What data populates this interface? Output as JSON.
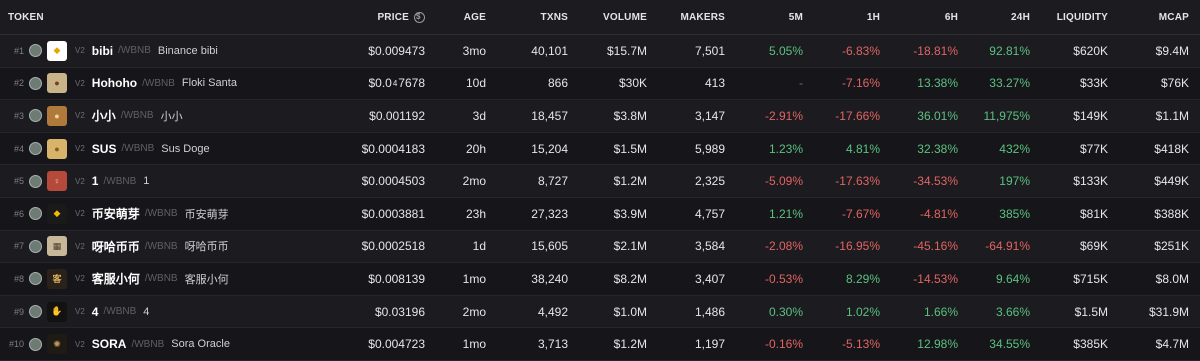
{
  "columns": {
    "token": "TOKEN",
    "price": "PRICE",
    "age": "AGE",
    "txns": "TXNS",
    "volume": "VOLUME",
    "makers": "MAKERS",
    "m5": "5M",
    "h1": "1H",
    "h6": "6H",
    "h24": "24H",
    "liquidity": "LIQUIDITY",
    "mcap": "MCAP"
  },
  "colors": {
    "positive": "#5bc17f",
    "negative": "#e16462",
    "background": "#16161a"
  },
  "rows": [
    {
      "rank": "#1",
      "version": "V2",
      "symbol": "bibi",
      "quote": "/WBNB",
      "name": "Binance bibi",
      "logo": "bibi-logo-icon",
      "logo_bg": "#ffffff",
      "logo_fg": "#e0a800",
      "logo_text": "◆",
      "price": "$0.009473",
      "age": "3mo",
      "txns": "40,101",
      "volume": "$15.7M",
      "makers": "7,501",
      "m5": "5.05%",
      "m5_dir": "pos",
      "h1": "-6.83%",
      "h1_dir": "neg",
      "h6": "-18.81%",
      "h6_dir": "neg",
      "h24": "92.81%",
      "h24_dir": "pos",
      "liquidity": "$620K",
      "mcap": "$9.4M"
    },
    {
      "rank": "#2",
      "version": "V2",
      "symbol": "Hohoho",
      "quote": "/WBNB",
      "name": "Floki Santa",
      "logo": "floki-santa-logo-icon",
      "logo_bg": "#c9b48a",
      "logo_fg": "#7a3b1e",
      "logo_text": "●",
      "price_prefix": "$0.0",
      "price_sub": "4",
      "price_tail": "7678",
      "age": "10d",
      "txns": "866",
      "volume": "$30K",
      "makers": "413",
      "m5": "-",
      "m5_dir": "dim",
      "h1": "-7.16%",
      "h1_dir": "neg",
      "h6": "13.38%",
      "h6_dir": "pos",
      "h24": "33.27%",
      "h24_dir": "pos",
      "liquidity": "$33K",
      "mcap": "$76K"
    },
    {
      "rank": "#3",
      "version": "V2",
      "symbol": "小小",
      "quote": "/WBNB",
      "name": "小小",
      "logo": "xiaoxiao-logo-icon",
      "logo_bg": "#b07a3a",
      "logo_fg": "#f2d3a0",
      "logo_text": "●",
      "price": "$0.001192",
      "age": "3d",
      "txns": "18,457",
      "volume": "$3.8M",
      "makers": "3,147",
      "m5": "-2.91%",
      "m5_dir": "neg",
      "h1": "-17.66%",
      "h1_dir": "neg",
      "h6": "36.01%",
      "h6_dir": "pos",
      "h24": "11,975%",
      "h24_dir": "pos",
      "liquidity": "$149K",
      "mcap": "$1.1M"
    },
    {
      "rank": "#4",
      "version": "V2",
      "symbol": "SUS",
      "quote": "/WBNB",
      "name": "Sus Doge",
      "logo": "sus-doge-logo-icon",
      "logo_bg": "#d8b46a",
      "logo_fg": "#8a5a1e",
      "logo_text": "●",
      "price": "$0.0004183",
      "age": "20h",
      "txns": "15,204",
      "volume": "$1.5M",
      "makers": "5,989",
      "m5": "1.23%",
      "m5_dir": "pos",
      "h1": "4.81%",
      "h1_dir": "pos",
      "h6": "32.38%",
      "h6_dir": "pos",
      "h24": "432%",
      "h24_dir": "pos",
      "liquidity": "$77K",
      "mcap": "$418K"
    },
    {
      "rank": "#5",
      "version": "V2",
      "symbol": "1",
      "quote": "/WBNB",
      "name": "1",
      "logo": "one-logo-icon",
      "logo_bg": "#b54a3a",
      "logo_fg": "#f0d0b0",
      "logo_text": "♀",
      "price": "$0.0004503",
      "age": "2mo",
      "txns": "8,727",
      "volume": "$1.2M",
      "makers": "2,325",
      "m5": "-5.09%",
      "m5_dir": "neg",
      "h1": "-17.63%",
      "h1_dir": "neg",
      "h6": "-34.53%",
      "h6_dir": "neg",
      "h24": "197%",
      "h24_dir": "pos",
      "liquidity": "$133K",
      "mcap": "$449K"
    },
    {
      "rank": "#6",
      "version": "V2",
      "symbol": "币安萌芽",
      "quote": "/WBNB",
      "name": "币安萌芽",
      "logo": "binance-sprout-logo-icon",
      "logo_bg": "#1a1a1a",
      "logo_fg": "#f0b90b",
      "logo_text": "◆",
      "price": "$0.0003881",
      "age": "23h",
      "txns": "27,323",
      "volume": "$3.9M",
      "makers": "4,757",
      "m5": "1.21%",
      "m5_dir": "pos",
      "h1": "-7.67%",
      "h1_dir": "neg",
      "h6": "-4.81%",
      "h6_dir": "neg",
      "h24": "385%",
      "h24_dir": "pos",
      "liquidity": "$81K",
      "mcap": "$388K"
    },
    {
      "rank": "#7",
      "version": "V2",
      "symbol": "呀哈币币",
      "quote": "/WBNB",
      "name": "呀哈币币",
      "logo": "yaha-logo-icon",
      "logo_bg": "#c8b89a",
      "logo_fg": "#4a3a2a",
      "logo_text": "▦",
      "price": "$0.0002518",
      "age": "1d",
      "txns": "15,605",
      "volume": "$2.1M",
      "makers": "3,584",
      "m5": "-2.08%",
      "m5_dir": "neg",
      "h1": "-16.95%",
      "h1_dir": "neg",
      "h6": "-45.16%",
      "h6_dir": "neg",
      "h24": "-64.91%",
      "h24_dir": "neg",
      "liquidity": "$69K",
      "mcap": "$251K"
    },
    {
      "rank": "#8",
      "version": "V2",
      "symbol": "客服小何",
      "quote": "/WBNB",
      "name": "客服小何",
      "logo": "kefu-logo-icon",
      "logo_bg": "#2a2218",
      "logo_fg": "#e0b060",
      "logo_text": "客",
      "price": "$0.008139",
      "age": "1mo",
      "txns": "38,240",
      "volume": "$8.2M",
      "makers": "3,407",
      "m5": "-0.53%",
      "m5_dir": "neg",
      "h1": "8.29%",
      "h1_dir": "pos",
      "h6": "-14.53%",
      "h6_dir": "neg",
      "h24": "9.64%",
      "h24_dir": "pos",
      "liquidity": "$715K",
      "mcap": "$8.0M"
    },
    {
      "rank": "#9",
      "version": "V2",
      "symbol": "4",
      "quote": "/WBNB",
      "name": "4",
      "logo": "hand-logo-icon",
      "logo_bg": "#121212",
      "logo_fg": "#e8b84a",
      "logo_text": "✋",
      "price": "$0.03196",
      "age": "2mo",
      "txns": "4,492",
      "volume": "$1.0M",
      "makers": "1,486",
      "m5": "0.30%",
      "m5_dir": "pos",
      "h1": "1.02%",
      "h1_dir": "pos",
      "h6": "1.66%",
      "h6_dir": "pos",
      "h24": "3.66%",
      "h24_dir": "pos",
      "liquidity": "$1.5M",
      "mcap": "$31.9M"
    },
    {
      "rank": "#10",
      "version": "V2",
      "symbol": "SORA",
      "quote": "/WBNB",
      "name": "Sora Oracle",
      "logo": "sora-logo-icon",
      "logo_bg": "#1e1a14",
      "logo_fg": "#c89a5a",
      "logo_text": "✺",
      "price": "$0.004723",
      "age": "1mo",
      "txns": "3,713",
      "volume": "$1.2M",
      "makers": "1,197",
      "m5": "-0.16%",
      "m5_dir": "neg",
      "h1": "-5.13%",
      "h1_dir": "neg",
      "h6": "12.98%",
      "h6_dir": "pos",
      "h24": "34.55%",
      "h24_dir": "pos",
      "liquidity": "$385K",
      "mcap": "$4.7M"
    }
  ]
}
